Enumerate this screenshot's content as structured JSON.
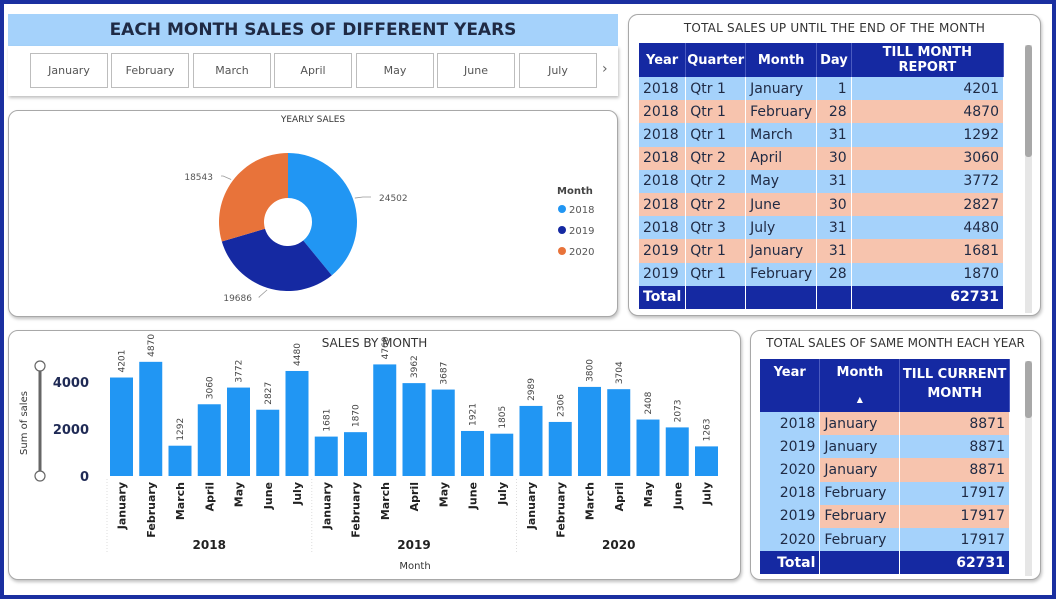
{
  "title": "EACH MONTH SALES OF DIFFERENT YEARS",
  "slicer": {
    "items": [
      "January",
      "February",
      "March",
      "April",
      "May",
      "June",
      "July"
    ],
    "next_glyph": "›"
  },
  "yearly_sales": {
    "title": "YEARLY SALES",
    "legend_title": "Month",
    "legend": [
      {
        "label": "2018",
        "color": "#2196f3"
      },
      {
        "label": "2019",
        "color": "#1529a2"
      },
      {
        "label": "2020",
        "color": "#e8733a"
      }
    ]
  },
  "top_table": {
    "title": "TOTAL SALES UP UNTIL THE END OF THE MONTH",
    "headers": [
      "Year",
      "Quarter",
      "Month",
      "Day",
      "TILL MONTH REPORT"
    ],
    "rows": [
      [
        "2018",
        "Qtr 1",
        "January",
        "1",
        "4201"
      ],
      [
        "2018",
        "Qtr 1",
        "February",
        "28",
        "4870"
      ],
      [
        "2018",
        "Qtr 1",
        "March",
        "31",
        "1292"
      ],
      [
        "2018",
        "Qtr 2",
        "April",
        "30",
        "3060"
      ],
      [
        "2018",
        "Qtr 2",
        "May",
        "31",
        "3772"
      ],
      [
        "2018",
        "Qtr 2",
        "June",
        "30",
        "2827"
      ],
      [
        "2018",
        "Qtr 3",
        "July",
        "31",
        "4480"
      ],
      [
        "2019",
        "Qtr 1",
        "January",
        "31",
        "1681"
      ],
      [
        "2019",
        "Qtr 1",
        "February",
        "28",
        "1870"
      ]
    ],
    "total_label": "Total",
    "total_value": "62731"
  },
  "bottom_table": {
    "title": "TOTAL SALES OF SAME MONTH EACH YEAR",
    "headers": [
      "Year",
      "Month",
      "TILL CURRENT MONTH"
    ],
    "sort_glyph": "▲",
    "rows": [
      [
        "2018",
        "January",
        "8871"
      ],
      [
        "2019",
        "January",
        "8871"
      ],
      [
        "2020",
        "January",
        "8871"
      ],
      [
        "2018",
        "February",
        "17917"
      ],
      [
        "2019",
        "February",
        "17917"
      ],
      [
        "2020",
        "February",
        "17917"
      ]
    ],
    "total_label": "Total",
    "total_value": "62731"
  },
  "chart_data": [
    {
      "type": "pie",
      "title": "YEARLY SALES",
      "legend_title": "Month",
      "categories": [
        "2018",
        "2019",
        "2020"
      ],
      "values": [
        24502,
        19686,
        18543
      ],
      "colors": [
        "#2196f3",
        "#1529a2",
        "#e8733a"
      ],
      "donut": true,
      "legend": "right"
    },
    {
      "type": "bar",
      "title": "SALES BY MONTH",
      "xlabel": "Month",
      "ylabel": "Sum of sales",
      "groups": [
        "2018",
        "2019",
        "2020"
      ],
      "categories": [
        "January",
        "February",
        "March",
        "April",
        "May",
        "June",
        "July"
      ],
      "series": [
        {
          "group": "2018",
          "values": [
            4201,
            4870,
            1292,
            3060,
            3772,
            2827,
            4480
          ]
        },
        {
          "group": "2019",
          "values": [
            1681,
            1870,
            4760,
            3962,
            3687,
            1921,
            1805
          ]
        },
        {
          "group": "2020",
          "values": [
            2989,
            2306,
            3800,
            3704,
            2408,
            2073,
            1263
          ]
        }
      ],
      "yticks": [
        0,
        2000,
        4000
      ],
      "ylim": [
        0,
        5000
      ],
      "color": "#2196f3",
      "grid": false
    }
  ]
}
